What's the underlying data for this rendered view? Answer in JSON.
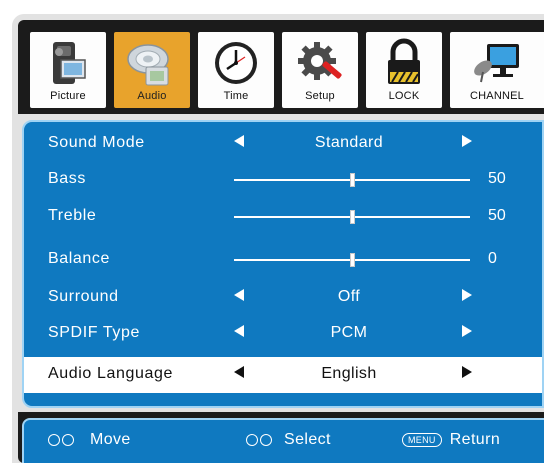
{
  "tabs": [
    {
      "label": "Picture",
      "icon": "camcorder-icon",
      "active": false
    },
    {
      "label": "Audio",
      "icon": "speaker-icon",
      "active": true
    },
    {
      "label": "Time",
      "icon": "clock-icon",
      "active": false
    },
    {
      "label": "Setup",
      "icon": "gear-wrench-icon",
      "active": false
    },
    {
      "label": "LOCK",
      "icon": "padlock-icon",
      "active": false
    },
    {
      "label": "CHANNEL",
      "icon": "satellite-tv-icon",
      "active": false
    }
  ],
  "menu": {
    "rows": [
      {
        "label": "Sound Mode",
        "type": "select",
        "value": "Standard"
      },
      {
        "label": "Bass",
        "type": "slider",
        "value": "50",
        "level": 0.5
      },
      {
        "label": "Treble",
        "type": "slider",
        "value": "50",
        "level": 0.5
      },
      {
        "label": "Balance",
        "type": "slider",
        "value": "0",
        "level": 0.5
      },
      {
        "label": "Surround",
        "type": "select",
        "value": "Off"
      },
      {
        "label": "SPDIF Type",
        "type": "select",
        "value": "PCM"
      },
      {
        "label": "Audio Language",
        "type": "select",
        "value": "English",
        "selected": true
      }
    ]
  },
  "footer": {
    "move_label": "Move",
    "select_label": "Select",
    "menu_key": "MENU",
    "return_label": "Return"
  },
  "colors": {
    "panel_blue": "#0f79c0",
    "active_tab": "#e8a32c",
    "frame_dark": "#1b1b1b",
    "highlight_row": "#ffffff"
  }
}
